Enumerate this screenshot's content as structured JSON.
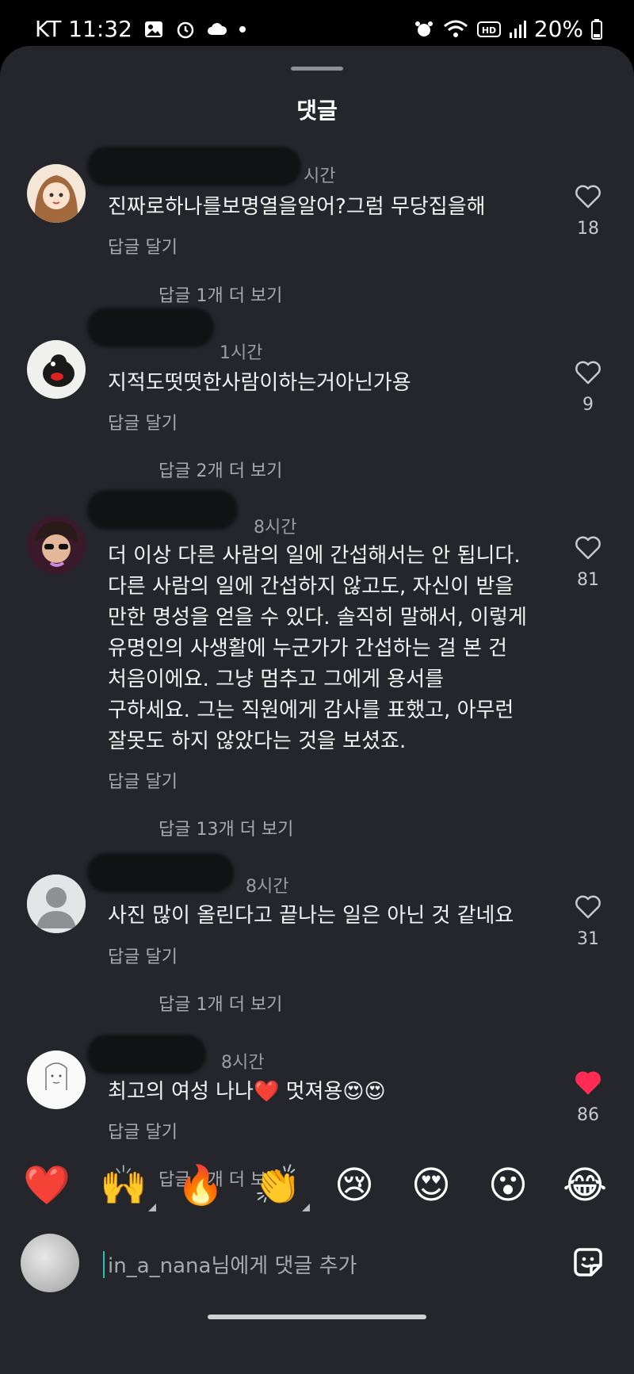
{
  "status_bar": {
    "carrier_time": "KT 11:32",
    "battery": "20%"
  },
  "sheet": {
    "title": "댓글"
  },
  "comments": [
    {
      "time": "시간",
      "text": "진짜로하나를보명열을알어?그럼 무당집을해",
      "reply_label": "답글 달기",
      "more_replies": "답글 1개 더 보기",
      "likes": "18",
      "liked": false
    },
    {
      "time": "1시간",
      "text": "지적도떳떳한사람이하는거아닌가용",
      "reply_label": "답글 달기",
      "more_replies": "답글 2개 더 보기",
      "likes": "9",
      "liked": false
    },
    {
      "time": "8시간",
      "text": "더 이상 다른 사람의 일에 간섭해서는 안 됩니다.\n다른 사람의 일에 간섭하지 않고도, 자신이 받을\n만한 명성을 얻을 수 있다. 솔직히 말해서, 이렇게\n유명인의 사생활에 누군가가 간섭하는 걸 본 건\n처음이에요. 그냥 멈추고 그에게 용서를\n구하세요. 그는 직원에게 감사를 표했고, 아무런\n잘못도 하지 않았다는 것을 보셨죠.",
      "reply_label": "답글 달기",
      "more_replies": "답글 13개 더 보기",
      "likes": "81",
      "liked": false
    },
    {
      "time": "8시간",
      "text": "사진 많이 올린다고 끝나는 일은 아닌 것 같네요",
      "reply_label": "답글 달기",
      "more_replies": "답글 1개 더 보기",
      "likes": "31",
      "liked": false
    },
    {
      "time": "8시간",
      "text": "최고의 여성 나나❤️ 멋져용😍😍",
      "reply_label": "답글 달기",
      "more_replies": "답글 2개 더 보기",
      "likes": "86",
      "liked": true
    }
  ],
  "emoji_bar": [
    "❤️",
    "🙌",
    "🔥",
    "👏",
    "😢",
    "😍",
    "😮",
    "😂"
  ],
  "input": {
    "placeholder": "in_a_nana님에게 댓글 추가"
  },
  "colors": {
    "sheet_bg": "#25262b",
    "liked_heart": "#fe2c55",
    "accent_caret": "#27c2b5"
  }
}
